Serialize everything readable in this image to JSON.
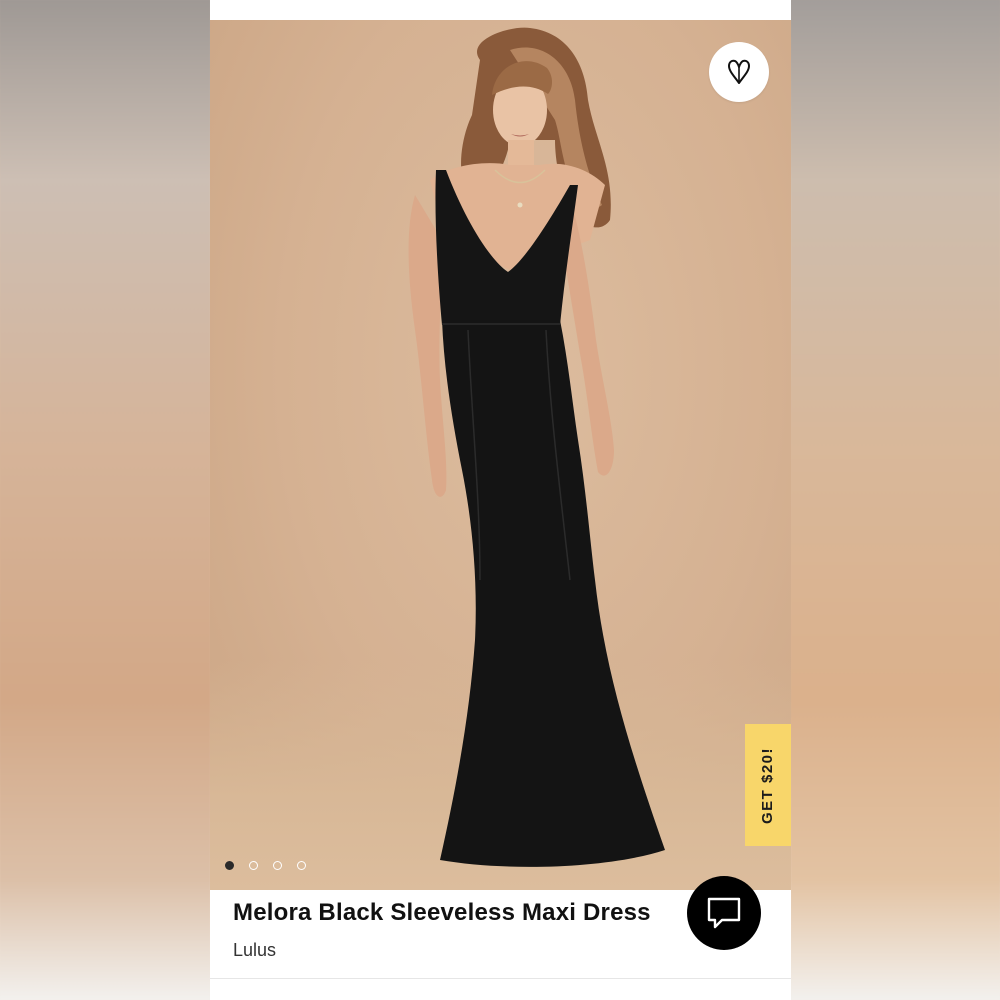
{
  "product": {
    "title": "Melora Black Sleeveless Maxi Dress",
    "brand": "Lulus"
  },
  "promo": {
    "label": "GET $20!"
  },
  "carousel": {
    "total": 4,
    "active_index": 0
  },
  "icons": {
    "favorite": "heart-outline-icon",
    "chat": "chat-bubble-icon"
  },
  "colors": {
    "promo_bg": "#f8d66a",
    "dress": "#141414",
    "backdrop": "#d5b192"
  }
}
